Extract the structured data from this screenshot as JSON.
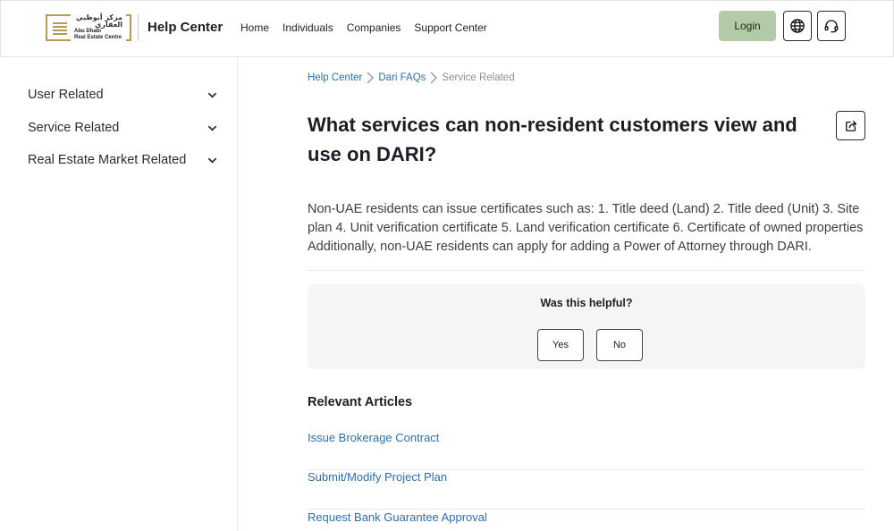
{
  "header": {
    "logo_arabic_line1": "مركز أبوظبي",
    "logo_arabic_line2": "العقاري",
    "logo_en_line1": "Abu Dhabi",
    "logo_en_line2": "Real Estate Centre",
    "brand_title": "Help Center",
    "nav": [
      "Home",
      "Individuals",
      "Companies",
      "Support Center"
    ],
    "login_label": "Login",
    "globe_icon": "globe-icon",
    "support_icon": "headset-icon",
    "accent_color": "#b3caa9"
  },
  "sidebar": {
    "items": [
      {
        "label": "User Related"
      },
      {
        "label": "Service Related"
      },
      {
        "label": "Real Estate Market Related"
      }
    ]
  },
  "breadcrumb": {
    "items": [
      "Help Center",
      "Dari FAQs",
      "Service Related"
    ]
  },
  "article": {
    "title": "What services can non-resident customers view and use on DARI?",
    "body": "Non-UAE residents can issue certificates such as: 1. Title deed (Land) 2. Title deed (Unit) 3. Site plan 4. Unit verification certificate 5. Land verification certificate 6. Certificate of owned properties Additionally, non-UAE residents can apply for adding a Power of Attorney through DARI.",
    "share_icon": "share-icon"
  },
  "feedback": {
    "question": "Was this helpful?",
    "yes_label": "Yes",
    "no_label": "No"
  },
  "relevant": {
    "title": "Relevant Articles",
    "items": [
      "Issue Brokerage Contract",
      "Submit/Modify Project Plan",
      "Request Bank Guarantee Approval"
    ]
  }
}
